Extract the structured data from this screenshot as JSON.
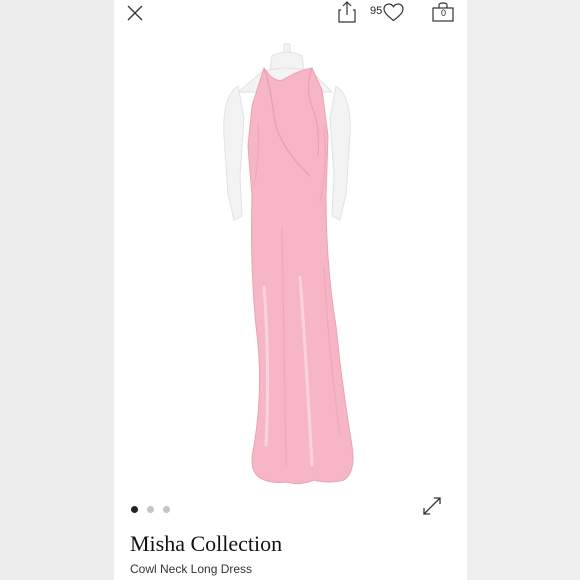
{
  "header": {
    "like_count": "95",
    "bag_count": "0",
    "icons": [
      "close-icon",
      "share-icon",
      "heart-icon",
      "bag-icon",
      "expand-icon"
    ]
  },
  "gallery": {
    "image_count": 3,
    "active_index": 0
  },
  "product": {
    "brand": "Misha Collection",
    "title": "Cowl Neck Long Dress"
  },
  "colors": {
    "dress": "#f6b6c6",
    "mannequin": "#f2f2f2",
    "panel": "#ffffff",
    "side": "#ededed"
  }
}
